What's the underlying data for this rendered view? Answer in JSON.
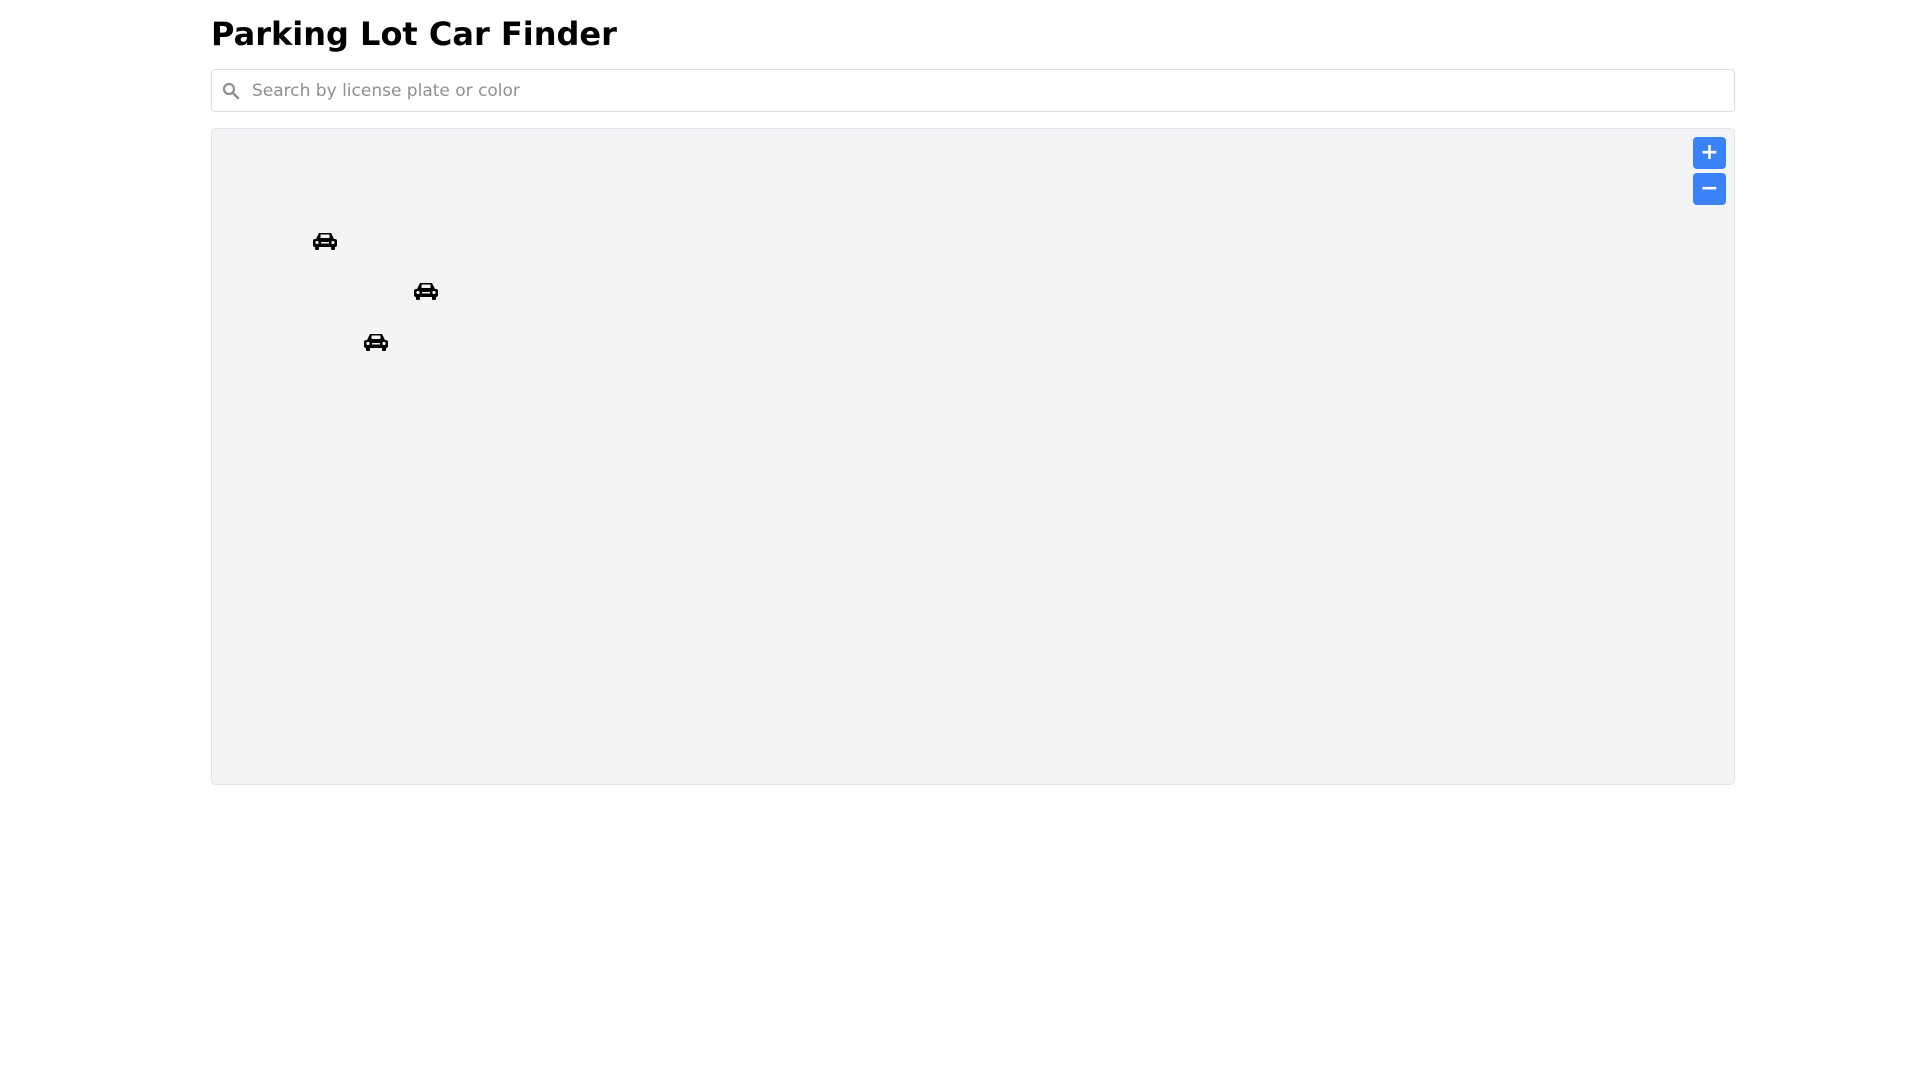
{
  "header": {
    "title": "Parking Lot Car Finder"
  },
  "search": {
    "placeholder": "Search by license plate or color",
    "value": ""
  },
  "lot": {
    "cars": [
      {
        "name": "car-1",
        "icon": "car-icon"
      },
      {
        "name": "car-2",
        "icon": "car-icon"
      },
      {
        "name": "car-3",
        "icon": "car-icon"
      }
    ],
    "zoom": {
      "in_label": "+",
      "out_label": "−"
    }
  },
  "colors": {
    "accent": "#3b82f6",
    "lot_background": "#f3f4f6",
    "car": "#000000"
  }
}
